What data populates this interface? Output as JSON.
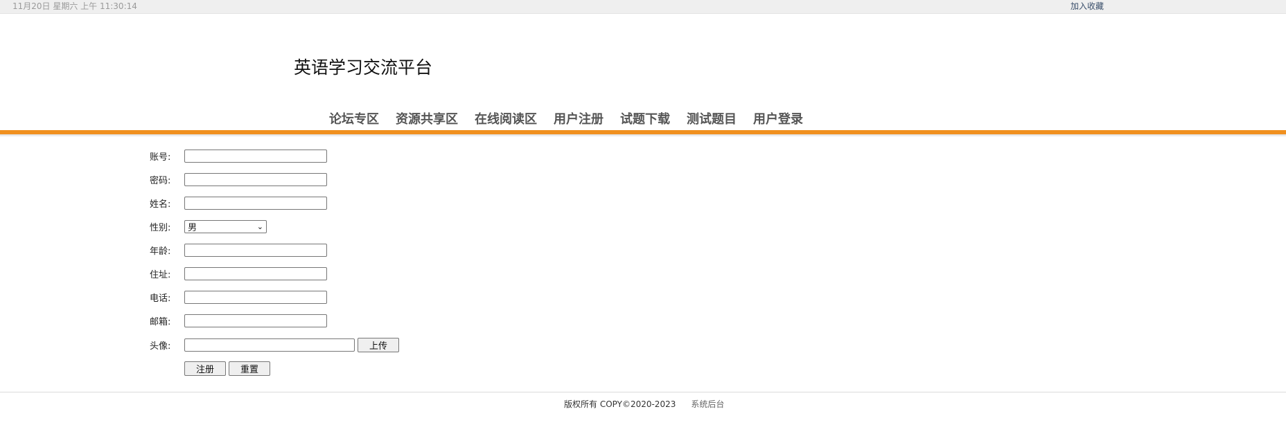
{
  "topbar": {
    "datetime": "11月20日 星期六 上午 11:30:14",
    "bookmark": "加入收藏"
  },
  "header": {
    "title": "英语学习交流平台"
  },
  "nav": {
    "items": [
      "论坛专区",
      "资源共享区",
      "在线阅读区",
      "用户注册",
      "试题下载",
      "测试题目",
      "用户登录"
    ]
  },
  "form": {
    "account_label": "账号:",
    "account_value": "",
    "password_label": "密码:",
    "password_value": "",
    "name_label": "姓名:",
    "name_value": "",
    "gender_label": "性别:",
    "gender_selected": "男",
    "age_label": "年龄:",
    "age_value": "",
    "address_label": "住址:",
    "address_value": "",
    "phone_label": "电话:",
    "phone_value": "",
    "email_label": "邮箱:",
    "email_value": "",
    "avatar_label": "头像:",
    "avatar_value": "",
    "upload_button": "上传",
    "register_button": "注册",
    "reset_button": "重置"
  },
  "footer": {
    "copyright": "版权所有 COPY©2020-2023",
    "admin_link": "系统后台"
  },
  "colors": {
    "accent": "#f0901f",
    "topbar_bg": "#efefef"
  }
}
